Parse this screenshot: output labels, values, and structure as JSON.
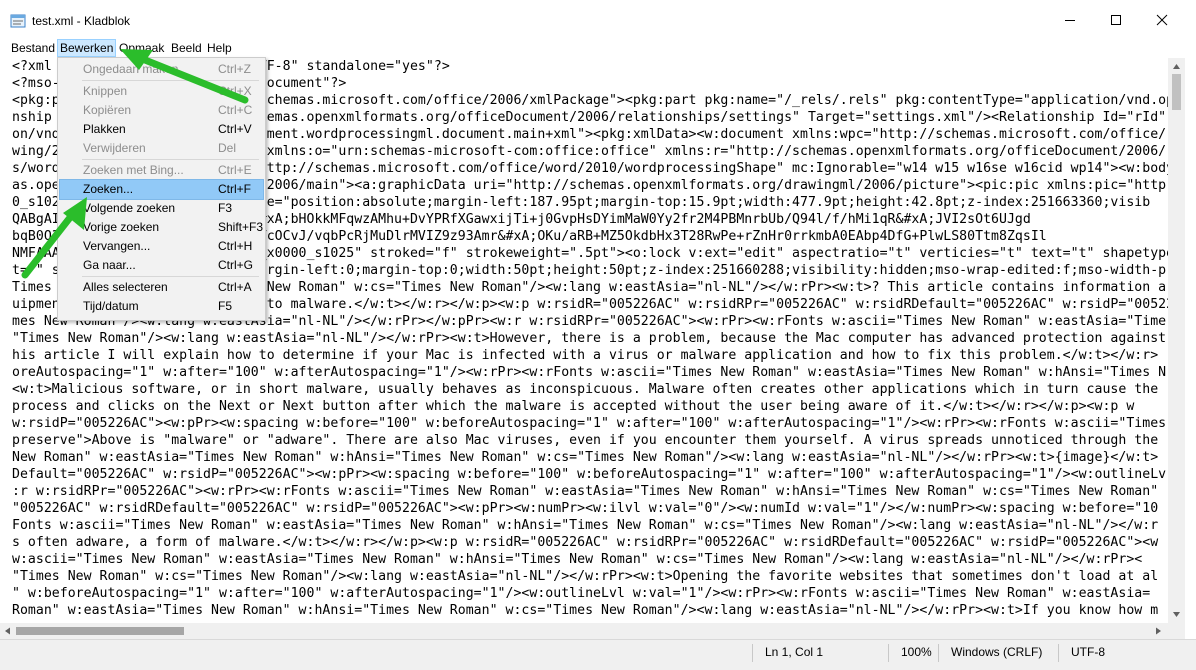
{
  "window": {
    "title": "test.xml - Kladblok"
  },
  "menu": {
    "items": [
      "Bestand",
      "Bewerken",
      "Opmaak",
      "Beeld",
      "Help"
    ]
  },
  "editor": {
    "lines": [
      "<?xml version=\"1.0\" encoding=\"UTF-8\" standalone=\"yes\"?>",
      "<?mso-application progid=\"Word.Document\"?>",
      "<pkg:package xmlns:pkg=\"http://schemas.microsoft.com/office/2006/xmlPackage\"><pkg:part pkg:name=\"/_rels/.rels\" pkg:contentType=\"application/vnd.openxmlformats-package.relationships+xml\">",
      "nship Id=\"rId1\" Type=\"http://schemas.openxmlformats.org/officeDocument/2006/relationships/settings\" Target=\"settings.xml\"/><Relationship Id=\"rId\"",
      "on/vnd.openxmlformats-officedocument.wordprocessingml.document.main+xml\"><pkg:xmlData><w:document xmlns:wpc=\"http://schemas.microsoft.com/office/",
      "wing/2010/wordprocessingCanvas\" xmlns:o=\"urn:schemas-microsoft-com:office:office\" xmlns:r=\"http://schemas.openxmlformats.org/officeDocument/2006/relationship",
      "s/word/2010/wordml\" xmlns:wps=\"http://schemas.microsoft.com/office/word/2010/wordprocessingShape\" mc:Ignorable=\"w14 w15 w16se w16cid wp14\"><w:body><w:p w:r",
      "as.openxmlformats.org/drawingml/2006/main\"><a:graphicData uri=\"http://schemas.openxmlformats.org/drawingml/2006/picture\"><pic:pic xmlns:pic=\"http",
      "0_s1026\" type=\"#_x0000_t75\" style=\"position:absolute;margin-left:187.95pt;margin-top:15.9pt;width:477.9pt;height:42.8pt;z-index:251663360;visib",
      "QABgAIAAAAIQBPAAAAX3JlbHMvLnJl&#xA;bHOkkMFqwzAMhu+DvYPRfXGawxijTi+j0GvpHsDYimMaW0Yy2fr2M4PBMnrbUb/Q94l/f/hMi1qR&#xA;JVI2sOt6UJgd",
      "bqB0Q3O6c+WLi+jsDFEaslb/HUdSEIjTcOCvJ/vqbPcRjMuDlrMVIZ9z93Amr&#xA;OKu/aRB+MZ5OkdbHx3T28RwPe+rZnHr0rrkmbA0EAbp4DfG+PlwLS80Ttm8ZqsIl",
      "NMFAAAAAAAAAA==\"/><v:shape id=\"_x0000_s1025\" stroked=\"f\" strokeweight=\".5pt\"><o:lock v:ext=\"edit\" aspectratio=\"t\" verticies=\"t\" text=\"t\" shapetype=\"t\"/></v:textb",
      "t=\"\" style=\"position:absolute;margin-left:0;margin-top:0;width:50pt;height:50pt;z-index:251660288;visibility:hidden;mso-wrap-edited:f;mso-width-p",
      "Times New Roman\" w:hAnsi=\"Times New Roman\" w:cs=\"Times New Roman\"/><w:lang w:eastAsia=\"nl-NL\"/></w:rPr><w:t>? This article contains information a",
      "uipment, especially in relation to malware.</w:t></w:r></w:p><w:p w:rsidR=\"005226AC\" w:rsidRPr=\"005226AC\" w:rsidRDefault=\"005226AC\" w:rsidP=\"00522",
      "mes New Roman\"/><w:lang w:eastAsia=\"nl-NL\"/></w:rPr></w:pPr><w:r w:rsidRPr=\"005226AC\"><w:rPr><w:rFonts w:ascii=\"Times New Roman\" w:eastAsia=\"Time",
      "\"Times New Roman\"/><w:lang w:eastAsia=\"nl-NL\"/></w:rPr><w:t>However, there is a problem, because the Mac computer has advanced protection against",
      "his article I will explain how to determine if your Mac is infected with a virus or malware application and how to fix this problem.</w:t></w:r>",
      "oreAutospacing=\"1\" w:after=\"100\" w:afterAutospacing=\"1\"/><w:rPr><w:rFonts w:ascii=\"Times New Roman\" w:eastAsia=\"Times New Roman\" w:hAnsi=\"Times N",
      "<w:t>Malicious software, or in short malware, usually behaves as inconspicuous. Malware often creates other applications which in turn cause the",
      "process and clicks on the Next or Next button after which the malware is accepted without the user being aware of it.</w:t></w:r></w:p><w:p w",
      "w:rsidP=\"005226AC\"><w:pPr><w:spacing w:before=\"100\" w:beforeAutospacing=\"1\" w:after=\"100\" w:afterAutospacing=\"1\"/><w:rPr><w:rFonts w:ascii=\"Times",
      "preserve\">Above is \"malware\" or \"adware\". There are also Mac viruses, even if you encounter them yourself. A virus spreads unnoticed through the",
      "New Roman\" w:eastAsia=\"Times New Roman\" w:hAnsi=\"Times New Roman\" w:cs=\"Times New Roman\"/><w:lang w:eastAsia=\"nl-NL\"/></w:rPr><w:t>{image}</w:t>",
      "Default=\"005226AC\" w:rsidP=\"005226AC\"><w:pPr><w:spacing w:before=\"100\" w:beforeAutospacing=\"1\" w:after=\"100\" w:afterAutospacing=\"1\"/><w:outlineLv",
      ":r w:rsidRPr=\"005226AC\"><w:rPr><w:rFonts w:ascii=\"Times New Roman\" w:eastAsia=\"Times New Roman\" w:hAnsi=\"Times New Roman\" w:cs=\"Times New Roman\"",
      "\"005226AC\" w:rsidRDefault=\"005226AC\" w:rsidP=\"005226AC\"><w:pPr><w:numPr><w:ilvl w:val=\"0\"/><w:numId w:val=\"1\"/></w:numPr><w:spacing w:before=\"10",
      "Fonts w:ascii=\"Times New Roman\" w:eastAsia=\"Times New Roman\" w:hAnsi=\"Times New Roman\" w:cs=\"Times New Roman\"/><w:lang w:eastAsia=\"nl-NL\"/></w:r",
      "s often adware, a form of malware.</w:t></w:r></w:p><w:p w:rsidR=\"005226AC\" w:rsidRPr=\"005226AC\" w:rsidRDefault=\"005226AC\" w:rsidP=\"005226AC\"><w",
      "w:ascii=\"Times New Roman\" w:eastAsia=\"Times New Roman\" w:hAnsi=\"Times New Roman\" w:cs=\"Times New Roman\"/><w:lang w:eastAsia=\"nl-NL\"/></w:rPr><",
      "\"Times New Roman\" w:cs=\"Times New Roman\"/><w:lang w:eastAsia=\"nl-NL\"/></w:rPr><w:t>Opening the favorite websites that sometimes don't load at al",
      "\" w:beforeAutospacing=\"1\" w:after=\"100\" w:afterAutospacing=\"1\"/><w:outlineLvl w:val=\"1\"/><w:rPr><w:rFonts w:ascii=\"Times New Roman\" w:eastAsia=",
      "Roman\" w:eastAsia=\"Times New Roman\" w:hAnsi=\"Times New Roman\" w:cs=\"Times New Roman\"/><w:lang w:eastAsia=\"nl-NL\"/></w:rPr><w:t>If you know how m"
    ]
  },
  "edit_menu": {
    "items": [
      {
        "label": "Ongedaan maken",
        "shortcut": "Ctrl+Z",
        "enabled": false
      },
      {
        "separator": true
      },
      {
        "label": "Knippen",
        "shortcut": "Ctrl+X",
        "enabled": false
      },
      {
        "label": "Kopiëren",
        "shortcut": "Ctrl+C",
        "enabled": false
      },
      {
        "label": "Plakken",
        "shortcut": "Ctrl+V",
        "enabled": true
      },
      {
        "label": "Verwijderen",
        "shortcut": "Del",
        "enabled": false
      },
      {
        "separator": true
      },
      {
        "label": "Zoeken met Bing...",
        "shortcut": "Ctrl+E",
        "enabled": false
      },
      {
        "label": "Zoeken...",
        "shortcut": "Ctrl+F",
        "enabled": true,
        "highlighted": true
      },
      {
        "label": "Volgende zoeken",
        "shortcut": "F3",
        "enabled": true
      },
      {
        "label": "Vorige zoeken",
        "shortcut": "Shift+F3",
        "enabled": true
      },
      {
        "label": "Vervangen...",
        "shortcut": "Ctrl+H",
        "enabled": true
      },
      {
        "label": "Ga naar...",
        "shortcut": "Ctrl+G",
        "enabled": true
      },
      {
        "separator": true
      },
      {
        "label": "Alles selecteren",
        "shortcut": "Ctrl+A",
        "enabled": true
      },
      {
        "label": "Tijd/datum",
        "shortcut": "F5",
        "enabled": true
      }
    ]
  },
  "status": {
    "position": "Ln 1, Col 1",
    "zoom": "100%",
    "line_ending": "Windows (CRLF)",
    "encoding": "UTF-8"
  },
  "colors": {
    "highlight": "#91c9f7",
    "annotation_arrow": "#2bbd2b",
    "disabled_text": "#8d8d8d"
  },
  "icons": {
    "app": "notepad-icon",
    "minimize": "minimize-icon",
    "maximize": "maximize-icon",
    "close": "close-icon"
  }
}
